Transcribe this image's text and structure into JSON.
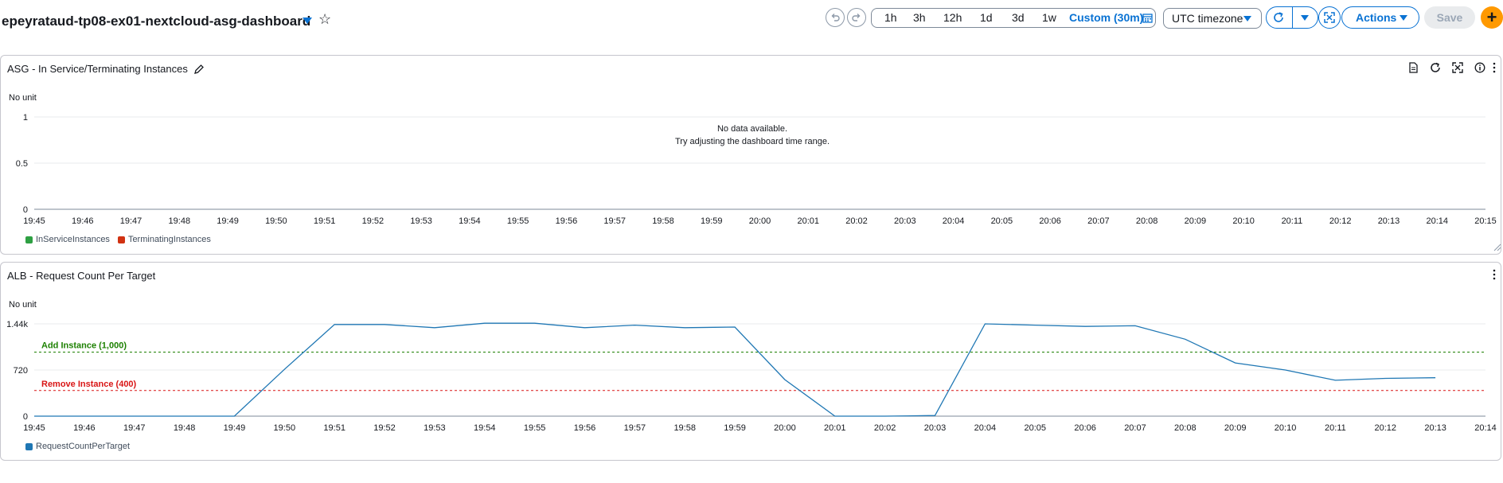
{
  "header": {
    "dashboard_name": "epeyrataud-tp08-ex01-nextcloud-asg-dashboard",
    "ranges": [
      "1h",
      "3h",
      "12h",
      "1d",
      "3d",
      "1w"
    ],
    "custom_range": "Custom (30m)",
    "timezone": "UTC timezone",
    "actions_label": "Actions",
    "save_label": "Save",
    "add_label": "+"
  },
  "widgets": [
    {
      "title": "ASG - In Service/Terminating Instances",
      "unit_label": "No unit",
      "no_data_line1": "No data available.",
      "no_data_line2": "Try adjusting the dashboard time range.",
      "legend": [
        {
          "label": "InServiceInstances",
          "color": "#2ea043"
        },
        {
          "label": "TerminatingInstances",
          "color": "#d13212"
        }
      ]
    },
    {
      "title": "ALB - Request Count Per Target",
      "unit_label": "No unit",
      "legend": [
        {
          "label": "RequestCountPerTarget",
          "color": "#1f77b4"
        }
      ]
    }
  ],
  "chart_data": [
    {
      "type": "line",
      "title": "ASG - In Service/Terminating Instances",
      "ylabel": "No unit",
      "ylim": [
        0,
        1
      ],
      "yticks": [
        "0",
        "0.5",
        "1"
      ],
      "x": [
        "19:45",
        "19:46",
        "19:47",
        "19:48",
        "19:49",
        "19:50",
        "19:51",
        "19:52",
        "19:53",
        "19:54",
        "19:55",
        "19:56",
        "19:57",
        "19:58",
        "19:59",
        "20:00",
        "20:01",
        "20:02",
        "20:03",
        "20:04",
        "20:05",
        "20:06",
        "20:07",
        "20:08",
        "20:09",
        "20:10",
        "20:11",
        "20:12",
        "20:13",
        "20:14",
        "20:15"
      ],
      "series": [
        {
          "name": "InServiceInstances",
          "values": []
        },
        {
          "name": "TerminatingInstances",
          "values": []
        }
      ],
      "grid": true,
      "legend": "bottom-left"
    },
    {
      "type": "line",
      "title": "ALB - Request Count Per Target",
      "ylabel": "No unit",
      "ylim": [
        0,
        1440
      ],
      "yticks": [
        "0",
        "720",
        "1.44k"
      ],
      "x": [
        "19:45",
        "19:46",
        "19:47",
        "19:48",
        "19:49",
        "19:50",
        "19:51",
        "19:52",
        "19:53",
        "19:54",
        "19:55",
        "19:56",
        "19:57",
        "19:58",
        "19:59",
        "20:00",
        "20:01",
        "20:02",
        "20:03",
        "20:04",
        "20:05",
        "20:06",
        "20:07",
        "20:08",
        "20:09",
        "20:10",
        "20:11",
        "20:12",
        "20:13",
        "20:14"
      ],
      "series": [
        {
          "name": "RequestCountPerTarget",
          "color": "#1f77b4",
          "values": [
            0,
            0,
            0,
            0,
            0,
            730,
            1430,
            1430,
            1380,
            1450,
            1450,
            1380,
            1420,
            1380,
            1390,
            570,
            0,
            0,
            10,
            1440,
            1420,
            1400,
            1410,
            1200,
            830,
            720,
            560,
            590,
            600,
            null
          ]
        }
      ],
      "annotations": [
        {
          "label": "Add Instance (1,000)",
          "value": 1000,
          "color": "#1d8102"
        },
        {
          "label": "Remove Instance (400)",
          "value": 400,
          "color": "#d91515"
        }
      ],
      "grid": true,
      "legend": "bottom-left"
    }
  ]
}
